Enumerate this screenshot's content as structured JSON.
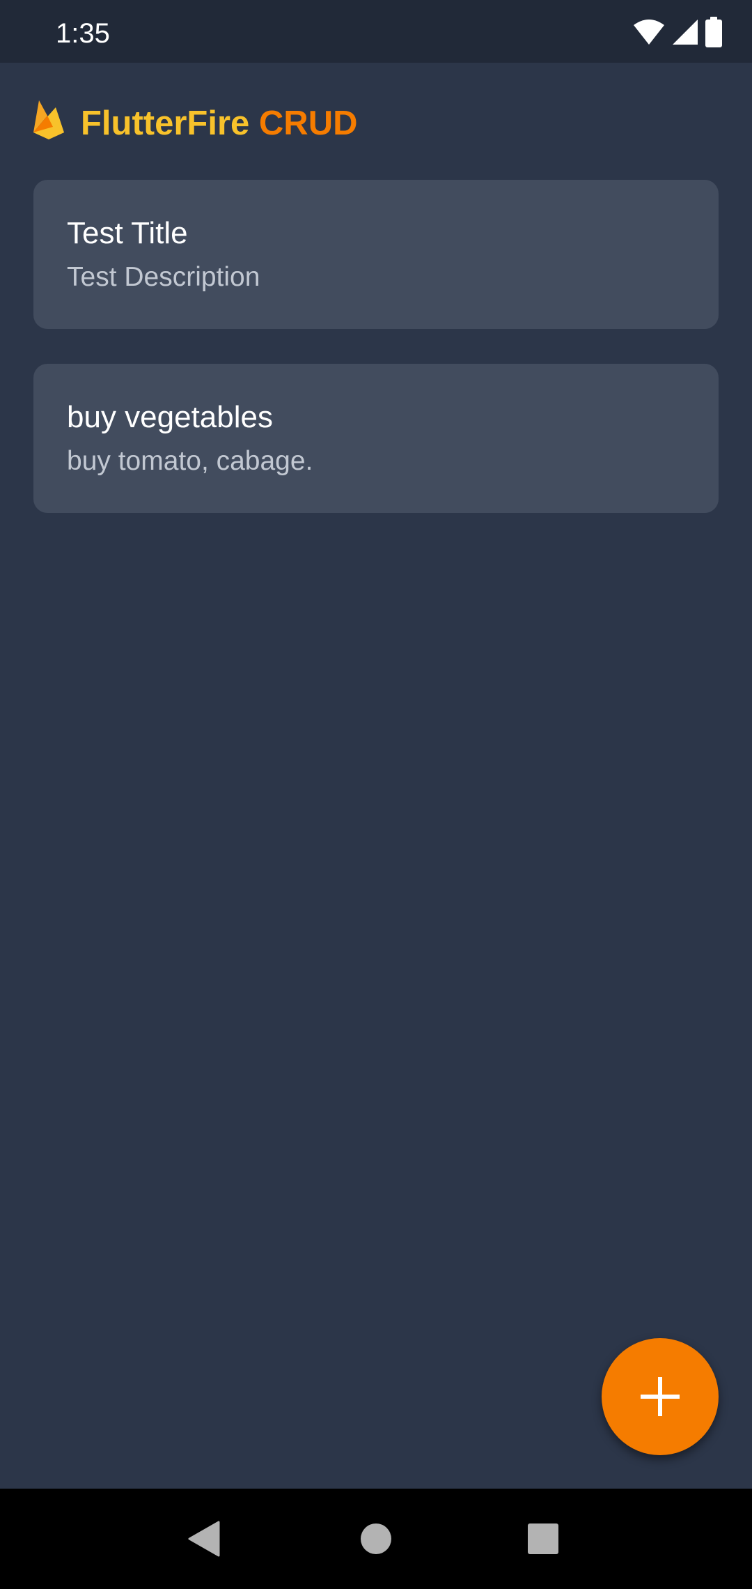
{
  "status_bar": {
    "time": "1:35",
    "icons": [
      "wifi-icon",
      "signal-icon",
      "battery-icon"
    ]
  },
  "app_bar": {
    "logo": "firebase-icon",
    "title_part1": "FlutterFire ",
    "title_part2": "CRUD",
    "colors": {
      "part1": "#f8c22b",
      "part2": "#f57c00"
    }
  },
  "items": [
    {
      "title": "Test Title",
      "description": "Test Description"
    },
    {
      "title": "buy vegetables",
      "description": "buy tomato, cabage."
    }
  ],
  "fab": {
    "icon": "plus-icon",
    "color": "#f57c00"
  },
  "nav_bar": {
    "buttons": [
      "back-icon",
      "home-icon",
      "recents-icon"
    ]
  },
  "colors": {
    "background": "#2c3649",
    "card": "#424c5e",
    "status_bar": "#212938"
  }
}
